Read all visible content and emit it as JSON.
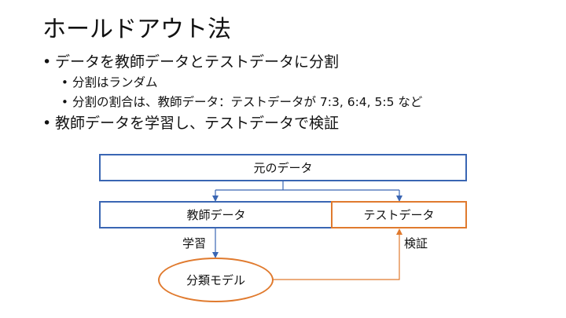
{
  "title": "ホールドアウト法",
  "bullets": {
    "b1": "データを教師データとテストデータに分割",
    "b1_sub1": "分割はランダム",
    "b1_sub2": "分割の割合は、教師データ：テストデータが 7:3, 6:4, 5:5 など",
    "b2": "教師データを学習し、テストデータで検証"
  },
  "diagram": {
    "original": "元のデータ",
    "training": "教師データ",
    "test": "テストデータ",
    "model": "分類モデル",
    "learn_label": "学習",
    "verify_label": "検証",
    "colors": {
      "blue": "#3a66b3",
      "orange": "#e07a2e"
    }
  }
}
